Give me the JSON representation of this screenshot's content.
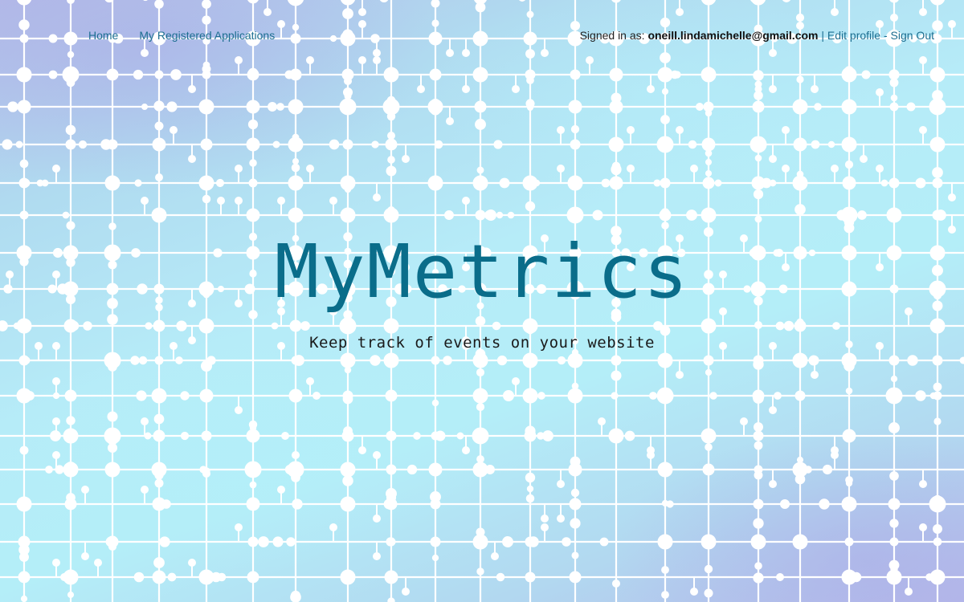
{
  "nav": {
    "home_label": "Home",
    "apps_label": "My Registered Applications",
    "signed_in_prefix": "Signed in as: ",
    "user_email": "oneill.lindamichelle@gmail.com",
    "separator": " | ",
    "edit_profile_label": "Edit profile",
    "dash": " - ",
    "sign_out_label": "Sign Out"
  },
  "hero": {
    "title": "MyMetrics",
    "subtitle": "Keep track of events on your website"
  },
  "colors": {
    "title": "#0a6d8a",
    "link": "#1d6f91",
    "pattern_lines": "#ffffff"
  }
}
